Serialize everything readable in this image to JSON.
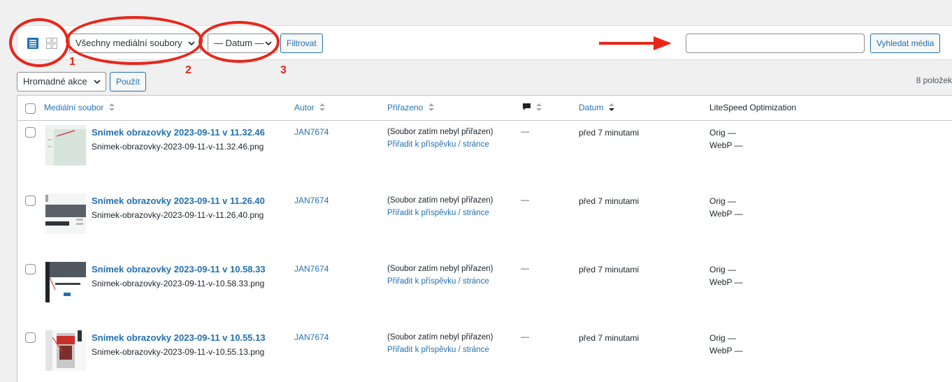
{
  "toolbar": {
    "media_type_filter": "Všechny mediální soubory",
    "date_filter": "— Datum —",
    "filter_button": "Filtrovat",
    "search_button": "Vyhledat média",
    "search_value": ""
  },
  "bulk": {
    "action_select": "Hromadné akce",
    "apply_button": "Použít"
  },
  "item_count": "8 položek",
  "annotations": {
    "labels": [
      "1",
      "2",
      "3"
    ],
    "color": "#e8261a"
  },
  "table": {
    "headers": {
      "file": "Mediální soubor",
      "author": "Autor",
      "attached": "Přiřazeno",
      "date": "Datum",
      "litespeed": "LiteSpeed Optimization"
    },
    "rows": [
      {
        "title": "Snímek obrazovky 2023-09-11 v 11.32.46",
        "filename": "Snimek-obrazovky-2023-09-11-v-11.32.46.png",
        "author": "JAN7674",
        "attached_status": "(Soubor zatím nebyl přiřazen)",
        "attach_link": "Přiřadit k příspěvku / stránce",
        "comments": "—",
        "date": "před 7 minutami",
        "ls_orig": "Orig —",
        "ls_webp": "WebP —"
      },
      {
        "title": "Snímek obrazovky 2023-09-11 v 11.26.40",
        "filename": "Snimek-obrazovky-2023-09-11-v-11.26.40.png",
        "author": "JAN7674",
        "attached_status": "(Soubor zatím nebyl přiřazen)",
        "attach_link": "Přiřadit k příspěvku / stránce",
        "comments": "—",
        "date": "před 7 minutami",
        "ls_orig": "Orig —",
        "ls_webp": "WebP —"
      },
      {
        "title": "Snímek obrazovky 2023-09-11 v 10.58.33",
        "filename": "Snimek-obrazovky-2023-09-11-v-10.58.33.png",
        "author": "JAN7674",
        "attached_status": "(Soubor zatím nebyl přiřazen)",
        "attach_link": "Přiřadit k příspěvku / stránce",
        "comments": "—",
        "date": "před 7 minutami",
        "ls_orig": "Orig —",
        "ls_webp": "WebP —"
      },
      {
        "title": "Snímek obrazovky 2023-09-11 v 10.55.13",
        "filename": "Snimek-obrazovky-2023-09-11-v-10.55.13.png",
        "author": "JAN7674",
        "attached_status": "(Soubor zatím nebyl přiřazen)",
        "attach_link": "Přiřadit k příspěvku / stránce",
        "comments": "—",
        "date": "před 7 minutami",
        "ls_orig": "Orig —",
        "ls_webp": "WebP —"
      }
    ]
  },
  "icons": {
    "list_view": "list-view-icon",
    "grid_view": "grid-view-icon",
    "comment": "comment-bubble-icon",
    "sort": "sort-arrows-icon",
    "sort_active": "sort-desc-icon",
    "arrow": "red-arrow-icon"
  },
  "colors": {
    "link": "#2271b1",
    "annotation": "#e8261a",
    "background": "#f0f0f1"
  }
}
